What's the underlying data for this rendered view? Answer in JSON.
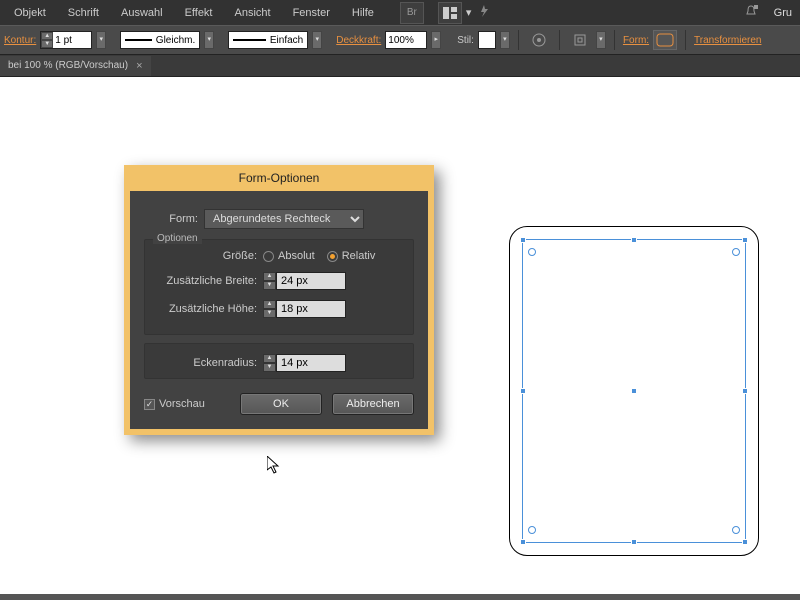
{
  "menubar": {
    "items": [
      "Objekt",
      "Schrift",
      "Auswahl",
      "Effekt",
      "Ansicht",
      "Fenster",
      "Hilfe"
    ],
    "right_text": "Gru"
  },
  "optionsbar": {
    "kontur_label": "Kontur:",
    "stroke_weight": "1 pt",
    "dash_style1": "Gleichm.",
    "dash_style2": "Einfach",
    "opacity_label": "Deckkraft:",
    "opacity_value": "100%",
    "stil_label": "Stil:",
    "form_label": "Form:",
    "transform_label": "Transformieren"
  },
  "tab": {
    "title": "bei 100 % (RGB/Vorschau)",
    "close": "×"
  },
  "dialog": {
    "title": "Form-Optionen",
    "form_label": "Form:",
    "form_value": "Abgerundetes Rechteck",
    "group_label": "Optionen",
    "size_label": "Größe:",
    "size_options": [
      "Absolut",
      "Relativ"
    ],
    "size_selected": "Relativ",
    "extra_width_label": "Zusätzliche Breite:",
    "extra_width_value": "24 px",
    "extra_height_label": "Zusätzliche Höhe:",
    "extra_height_value": "18 px",
    "radius_label": "Eckenradius:",
    "radius_value": "14 px",
    "preview_label": "Vorschau",
    "preview_checked": true,
    "ok_label": "OK",
    "cancel_label": "Abbrechen"
  },
  "canvas_object": {
    "type": "rounded-rectangle",
    "corner_radius_px": 14,
    "selected": true
  }
}
